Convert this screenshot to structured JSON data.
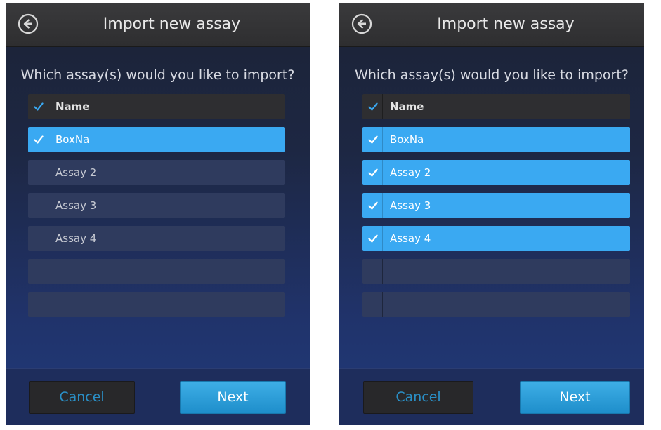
{
  "left_screen": {
    "title": "Import new assay",
    "question": "Which assay(s) would you like to import?",
    "header": {
      "label": "Name",
      "checked": true
    },
    "rows": [
      {
        "label": "BoxNa",
        "checked": true
      },
      {
        "label": "Assay 2",
        "checked": false
      },
      {
        "label": "Assay 3",
        "checked": false
      },
      {
        "label": "Assay 4",
        "checked": false
      },
      {
        "label": "",
        "checked": false
      },
      {
        "label": "",
        "checked": false
      }
    ],
    "cancel_label": "Cancel",
    "next_label": "Next"
  },
  "right_screen": {
    "title": "Import new assay",
    "question": "Which assay(s) would you like to import?",
    "header": {
      "label": "Name",
      "checked": true
    },
    "rows": [
      {
        "label": "BoxNa",
        "checked": true
      },
      {
        "label": "Assay 2",
        "checked": true
      },
      {
        "label": "Assay 3",
        "checked": true
      },
      {
        "label": "Assay 4",
        "checked": true
      },
      {
        "label": "",
        "checked": false
      },
      {
        "label": "",
        "checked": false
      }
    ],
    "cancel_label": "Cancel",
    "next_label": "Next"
  },
  "icons": {
    "back": "back-arrow-icon",
    "check": "checkmark-icon"
  },
  "colors": {
    "selected_row": "#3aa9f2",
    "unselected_row": "#2f3b5e",
    "header_row": "#2e2e31",
    "next_button": "#2a9fd9",
    "cancel_text": "#2a8fc6",
    "check_on_dark": "#3aa9f2",
    "check_on_selected": "#ffffff"
  }
}
